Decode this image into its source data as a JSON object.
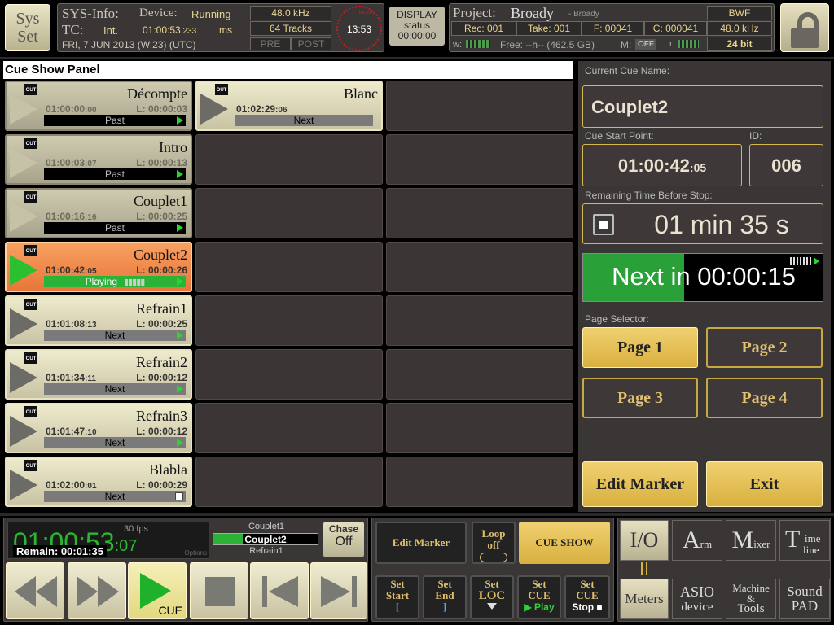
{
  "top": {
    "sys_line1": "Sys",
    "sys_line2": "Set",
    "sysinfo_label": "SYS-Info:",
    "device_label": "Device:",
    "device_status": "Running",
    "sample_rate": "48.0 kHz",
    "tc_label": "TC:",
    "tc_mode": "Int.",
    "tc_value": "01:00:53",
    "tc_ms": ".233",
    "ms_label": "ms",
    "tracks": "64 Tracks",
    "date": "FRI, 7 JUN 2013 (W:23) (UTC)",
    "pre": "PRE",
    "post": "POST",
    "clock": "13:53",
    "clock_label": "locked",
    "display_line1": "DISPLAY",
    "display_line2": "status",
    "display_line3": "00:00:00",
    "project_label": "Project:",
    "project_name": "Broady",
    "project_sub": "- Broady",
    "format": "BWF",
    "rec": "Rec: 001",
    "take": "Take: 001",
    "file": "F: 00041",
    "cue_num": "C: 000041",
    "proj_rate": "48.0 kHz",
    "bitdepth": "24 bit",
    "w_label": "w:",
    "free": "Free: --h-- (462.5 GB)",
    "m_label": "M:",
    "m_val": "OFF",
    "r_label": "r:"
  },
  "panel_title": "Cue Show Panel",
  "cues": [
    {
      "name": "Décompte",
      "tc": "01:00:00",
      "tcf": ":00",
      "len": "L: 00:00:03",
      "status": "Past",
      "state": "past",
      "icon": "green-triangle"
    },
    {
      "name": "Intro",
      "tc": "01:00:03",
      "tcf": ":07",
      "len": "L: 00:00:13",
      "status": "Past",
      "state": "past",
      "icon": "green-triangle"
    },
    {
      "name": "Couplet1",
      "tc": "01:00:16",
      "tcf": ":16",
      "len": "L: 00:00:25",
      "status": "Past",
      "state": "past",
      "icon": "green-triangle"
    },
    {
      "name": "Couplet2",
      "tc": "01:00:42",
      "tcf": ":05",
      "len": "L: 00:00:26",
      "status": "Playing",
      "state": "playing",
      "icon": "green-triangle"
    },
    {
      "name": "Refrain1",
      "tc": "01:01:08",
      "tcf": ":13",
      "len": "L: 00:00:25",
      "status": "Next",
      "state": "next",
      "icon": "green-triangle"
    },
    {
      "name": "Refrain2",
      "tc": "01:01:34",
      "tcf": ":11",
      "len": "L: 00:00:12",
      "status": "Next",
      "state": "next",
      "icon": "green-triangle"
    },
    {
      "name": "Refrain3",
      "tc": "01:01:47",
      "tcf": ":10",
      "len": "L: 00:00:12",
      "status": "Next",
      "state": "next",
      "icon": "green-triangle"
    },
    {
      "name": "Blabla",
      "tc": "01:02:00",
      "tcf": ":01",
      "len": "L: 00:00:29",
      "status": "Next",
      "state": "next",
      "icon": "white-square"
    }
  ],
  "cue2": {
    "name": "Blanc",
    "tc": "01:02:29",
    "tcf": ":06",
    "status": "Next"
  },
  "out_icon": "OUT",
  "right": {
    "current_label": "Current Cue Name:",
    "current_name": "Couplet2",
    "start_label": "Cue Start Point:",
    "start_tc": "01:00:42",
    "start_frames": ":05",
    "id_label": "ID:",
    "id_val": "006",
    "remain_label": "Remaining Time Before Stop:",
    "remain_val": "01 min 35 s",
    "next_in": "Next in 00:00:15",
    "page_label": "Page Selector:",
    "pages": [
      "Page 1",
      "Page 2",
      "Page 3",
      "Page 4"
    ],
    "edit_marker": "Edit Marker",
    "exit": "Exit"
  },
  "bottom": {
    "tc_big": "01:00:53",
    "tc_frames": ":07",
    "fps": "30 fps",
    "remain": "Remain: 00:01:35",
    "options": "Options",
    "cue_prev": "Couplet1",
    "cue_cur": "Couplet2",
    "cue_next": "Refrain1",
    "chase_label": "Chase",
    "chase_val": "Off",
    "cue_label": "CUE",
    "edit_marker": "Edit Marker",
    "loop1": "Loop",
    "loop2": "off",
    "cue_show": "CUE SHOW",
    "set_start1": "Set",
    "set_start2": "Start",
    "set_end1": "Set",
    "set_end2": "End",
    "set_loc1": "Set",
    "set_loc2": "LOC",
    "set_cue_play1": "Set",
    "set_cue_play2": "CUE",
    "play": "Play",
    "set_cue_stop1": "Set",
    "set_cue_stop2": "CUE",
    "stop": "Stop",
    "io": "I/O",
    "arm_big": "A",
    "arm_small": "rm",
    "mixer_big": "M",
    "mixer_small": "ixer",
    "timeline_big": "T",
    "timeline_small1": "ime",
    "timeline_small2": "line",
    "meters": "Meters",
    "asio1": "ASIO",
    "asio2": "device",
    "machine1": "Machine",
    "machine2": "&",
    "machine3": "Tools",
    "sound1": "Sound",
    "sound2": "PAD"
  }
}
